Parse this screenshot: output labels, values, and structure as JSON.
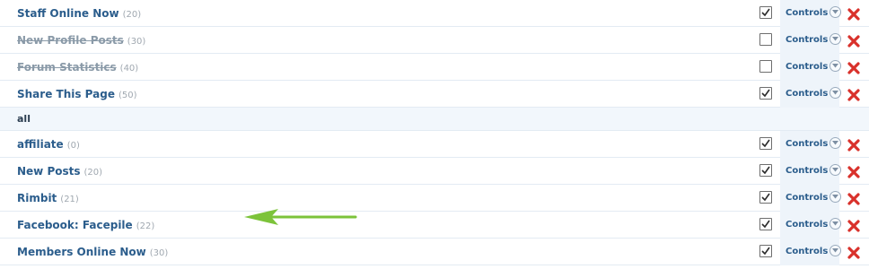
{
  "rows": [
    {
      "type": "item",
      "name": "Staff Online Now",
      "order": "(20)",
      "enabled": true,
      "checked": true,
      "controls": "Controls"
    },
    {
      "type": "item",
      "name": "New Profile Posts",
      "order": "(30)",
      "enabled": false,
      "checked": false,
      "controls": "Controls"
    },
    {
      "type": "item",
      "name": "Forum Statistics",
      "order": "(40)",
      "enabled": false,
      "checked": false,
      "controls": "Controls"
    },
    {
      "type": "item",
      "name": "Share This Page",
      "order": "(50)",
      "enabled": true,
      "checked": true,
      "controls": "Controls"
    },
    {
      "type": "group",
      "name": "all"
    },
    {
      "type": "item",
      "name": "affiliate",
      "order": "(0)",
      "enabled": true,
      "checked": true,
      "controls": "Controls"
    },
    {
      "type": "item",
      "name": "New Posts",
      "order": "(20)",
      "enabled": true,
      "checked": true,
      "controls": "Controls"
    },
    {
      "type": "item",
      "name": "Rimbit",
      "order": "(21)",
      "enabled": true,
      "checked": true,
      "controls": "Controls"
    },
    {
      "type": "item",
      "name": "Facebook: Facepile",
      "order": "(22)",
      "enabled": true,
      "checked": true,
      "controls": "Controls"
    },
    {
      "type": "item",
      "name": "Members Online Now",
      "order": "(30)",
      "enabled": true,
      "checked": true,
      "controls": "Controls"
    }
  ],
  "icons": {
    "controls": "chevron-down-icon",
    "delete": "delete-x-icon",
    "annotation": "arrow-left-icon"
  },
  "colors": {
    "link": "#2b5d8c",
    "disabled": "#8a9aa8",
    "delete": "#d9312b",
    "arrow": "#7cc33a",
    "controls_bg": "#eef4fa",
    "group_bg": "#f2f7fc"
  }
}
